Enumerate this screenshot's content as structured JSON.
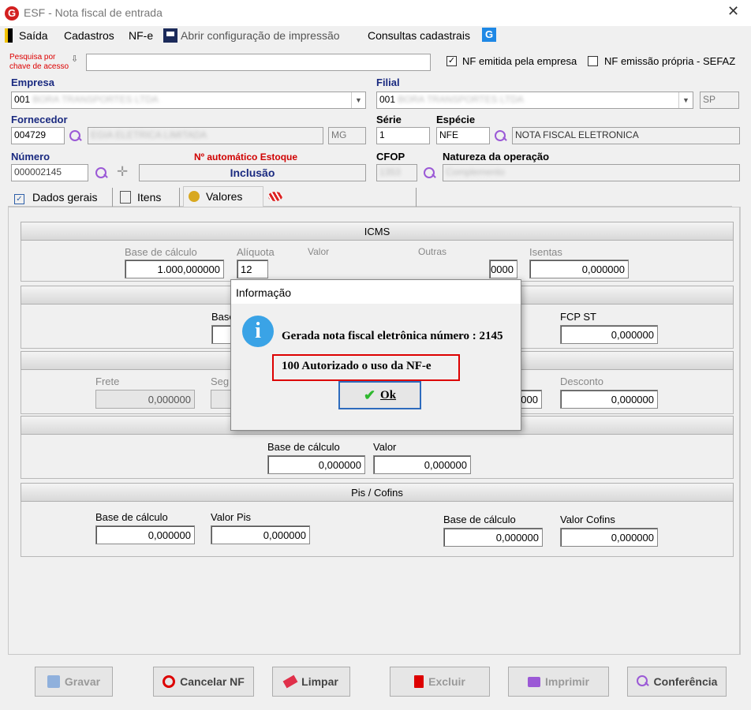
{
  "window": {
    "title": "ESF - Nota fiscal de entrada",
    "logo": "G"
  },
  "menu": {
    "saida": "Saída",
    "cadastros": "Cadastros",
    "nfe": "NF-e",
    "abrir_config": "Abrir configuração de impressão",
    "consultas": "Consultas cadastrais"
  },
  "pesquisa": {
    "label_line1": "Pesquisa por",
    "label_line2": "chave de acesso",
    "value": ""
  },
  "checkboxes": {
    "nf_emitida_label": "NF emitida pela empresa",
    "nf_emitida_checked": "✓",
    "nf_propria_label": "NF emissão própria - SEFAZ"
  },
  "empresa": {
    "label": "Empresa",
    "code": "001",
    "name": "BORA TRANSPORTES LTDA"
  },
  "filial": {
    "label": "Filial",
    "code": "001",
    "name": "BORA TRANSPORTES LTDA",
    "uf": "SP"
  },
  "fornecedor": {
    "label": "Fornecedor",
    "code": "004729",
    "name": "EGIA ELETRICA LIMITADA",
    "uf": "MG"
  },
  "serie": {
    "label": "Série",
    "value": "1"
  },
  "especie": {
    "label": "Espécie",
    "code": "NFE",
    "desc": "NOTA FISCAL ELETRONICA"
  },
  "numero": {
    "label": "Número",
    "value": "000002145",
    "auto_label": "Nº automático Estoque",
    "status": "Inclusão"
  },
  "cfop": {
    "label": "CFOP",
    "value": "1353"
  },
  "natureza": {
    "label": "Natureza da operação",
    "value": "Complemento"
  },
  "tabs": {
    "dados_gerais": "Dados gerais",
    "itens": "Itens",
    "valores": "Valores"
  },
  "icms": {
    "title": "ICMS",
    "base_label": "Base de cálculo",
    "base": "1.000,000000",
    "aliquota_label": "Alíquota",
    "aliquota": "12",
    "valor_label": "Valor",
    "outras_label": "Outras",
    "outras": "0000",
    "isentas_label": "Isentas",
    "isentas": "0,000000"
  },
  "fcp": {
    "base_label": "Base",
    "fcp_st_label": "FCP ST",
    "fcp_st": "0,000000"
  },
  "totais": {
    "frete_label": "Frete",
    "frete": "0,000000",
    "seguro_label": "Seg",
    "outras": "000",
    "desconto_label": "Desconto",
    "desconto": "0,000000"
  },
  "ipi": {
    "base_label": "Base de cálculo",
    "base": "0,000000",
    "valor_label": "Valor",
    "valor": "0,000000"
  },
  "pis_cofins": {
    "title": "Pis / Cofins",
    "base_pis_label": "Base de cálculo",
    "base_pis": "0,000000",
    "valor_pis_label": "Valor Pis",
    "valor_pis": "0,000000",
    "base_cofins_label": "Base de cálculo",
    "base_cofins": "0,000000",
    "valor_cofins_label": "Valor Cofins",
    "valor_cofins": "0,000000"
  },
  "buttons": {
    "gravar": "Gravar",
    "cancelar": "Cancelar NF",
    "limpar": "Limpar",
    "excluir": "Excluir",
    "imprimir": "Imprimir",
    "conferencia": "Conferência"
  },
  "dialog": {
    "title": "Informação",
    "message": "Gerada nota fiscal eletrônica número : 2145",
    "status": "100 Autorizado o uso da NF-e",
    "ok": "Ok",
    "icon": "i"
  },
  "colors": {
    "label_red": "#d00000",
    "label_blue": "#1a2a80",
    "accent_purple": "#9b59d6",
    "dialog_info": "#3aa3e6"
  }
}
